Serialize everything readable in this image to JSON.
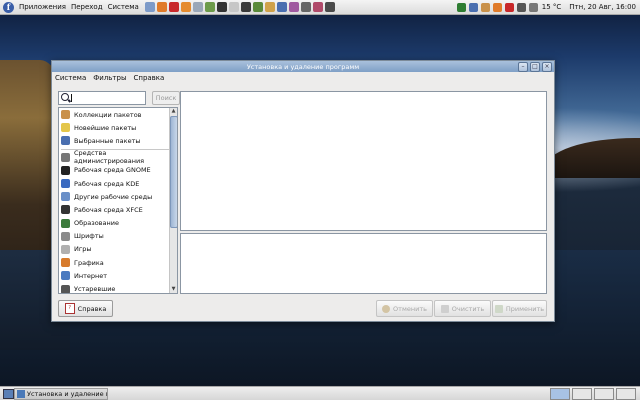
{
  "panel": {
    "menus": [
      "Приложения",
      "Переход",
      "Система"
    ],
    "launcher_icons": [
      "mail-icon",
      "firefox-icon",
      "opera-icon",
      "firefox-alt-icon",
      "document-icon",
      "music-icon",
      "terminal-icon",
      "app-icon",
      "player-icon",
      "media-icon",
      "editor-icon",
      "web-icon",
      "chat-icon",
      "settings-icon",
      "photo-icon",
      "screen-icon"
    ],
    "tray_icons": [
      "tree-icon",
      "user-icon",
      "weather-icon",
      "firefox-icon",
      "flag-icon",
      "network-icon",
      "sound-icon"
    ],
    "weather": "15 °C",
    "clock": "Птн, 20 Авг, 16:00"
  },
  "window": {
    "title": "Установка и удаление программ",
    "menubar": [
      "Система",
      "Фильтры",
      "Справка"
    ],
    "search_placeholder": "",
    "search_button": "Поиск",
    "categories": [
      {
        "label": "Коллекции пакетов",
        "icon": "package-collection-icon",
        "color": "#c9914a"
      },
      {
        "label": "Новейшие пакеты",
        "icon": "bulb-icon",
        "color": "#e4c64a"
      },
      {
        "label": "Выбранные пакеты",
        "icon": "magnifier-icon",
        "color": "#4a6fb0"
      },
      {
        "label": "Средства администрирования",
        "icon": "admin-tools-icon",
        "color": "#777777",
        "sep_before": true
      },
      {
        "label": "Рабочая среда GNOME",
        "icon": "gnome-icon",
        "color": "#222222"
      },
      {
        "label": "Рабочая среда KDE",
        "icon": "kde-icon",
        "color": "#3a6ac0"
      },
      {
        "label": "Другие рабочие среды",
        "icon": "desktops-icon",
        "color": "#6a8fc8"
      },
      {
        "label": "Рабочая среда XFCE",
        "icon": "xfce-icon",
        "color": "#333333"
      },
      {
        "label": "Образование",
        "icon": "education-icon",
        "color": "#3b7a3b"
      },
      {
        "label": "Шрифты",
        "icon": "fonts-icon",
        "color": "#8a8a8a"
      },
      {
        "label": "Игры",
        "icon": "games-icon",
        "color": "#b0b0b0"
      },
      {
        "label": "Графика",
        "icon": "graphics-icon",
        "color": "#d77b2c"
      },
      {
        "label": "Интернет",
        "icon": "internet-icon",
        "color": "#4a7ac0"
      },
      {
        "label": "Устаревшие",
        "icon": "legacy-icon",
        "color": "#555555"
      }
    ],
    "buttons": {
      "help": "Справка",
      "cancel": "Отменить",
      "clear": "Очистить",
      "apply": "Применить"
    }
  },
  "taskbar": {
    "task_label": "Установка и удаление пр..."
  }
}
